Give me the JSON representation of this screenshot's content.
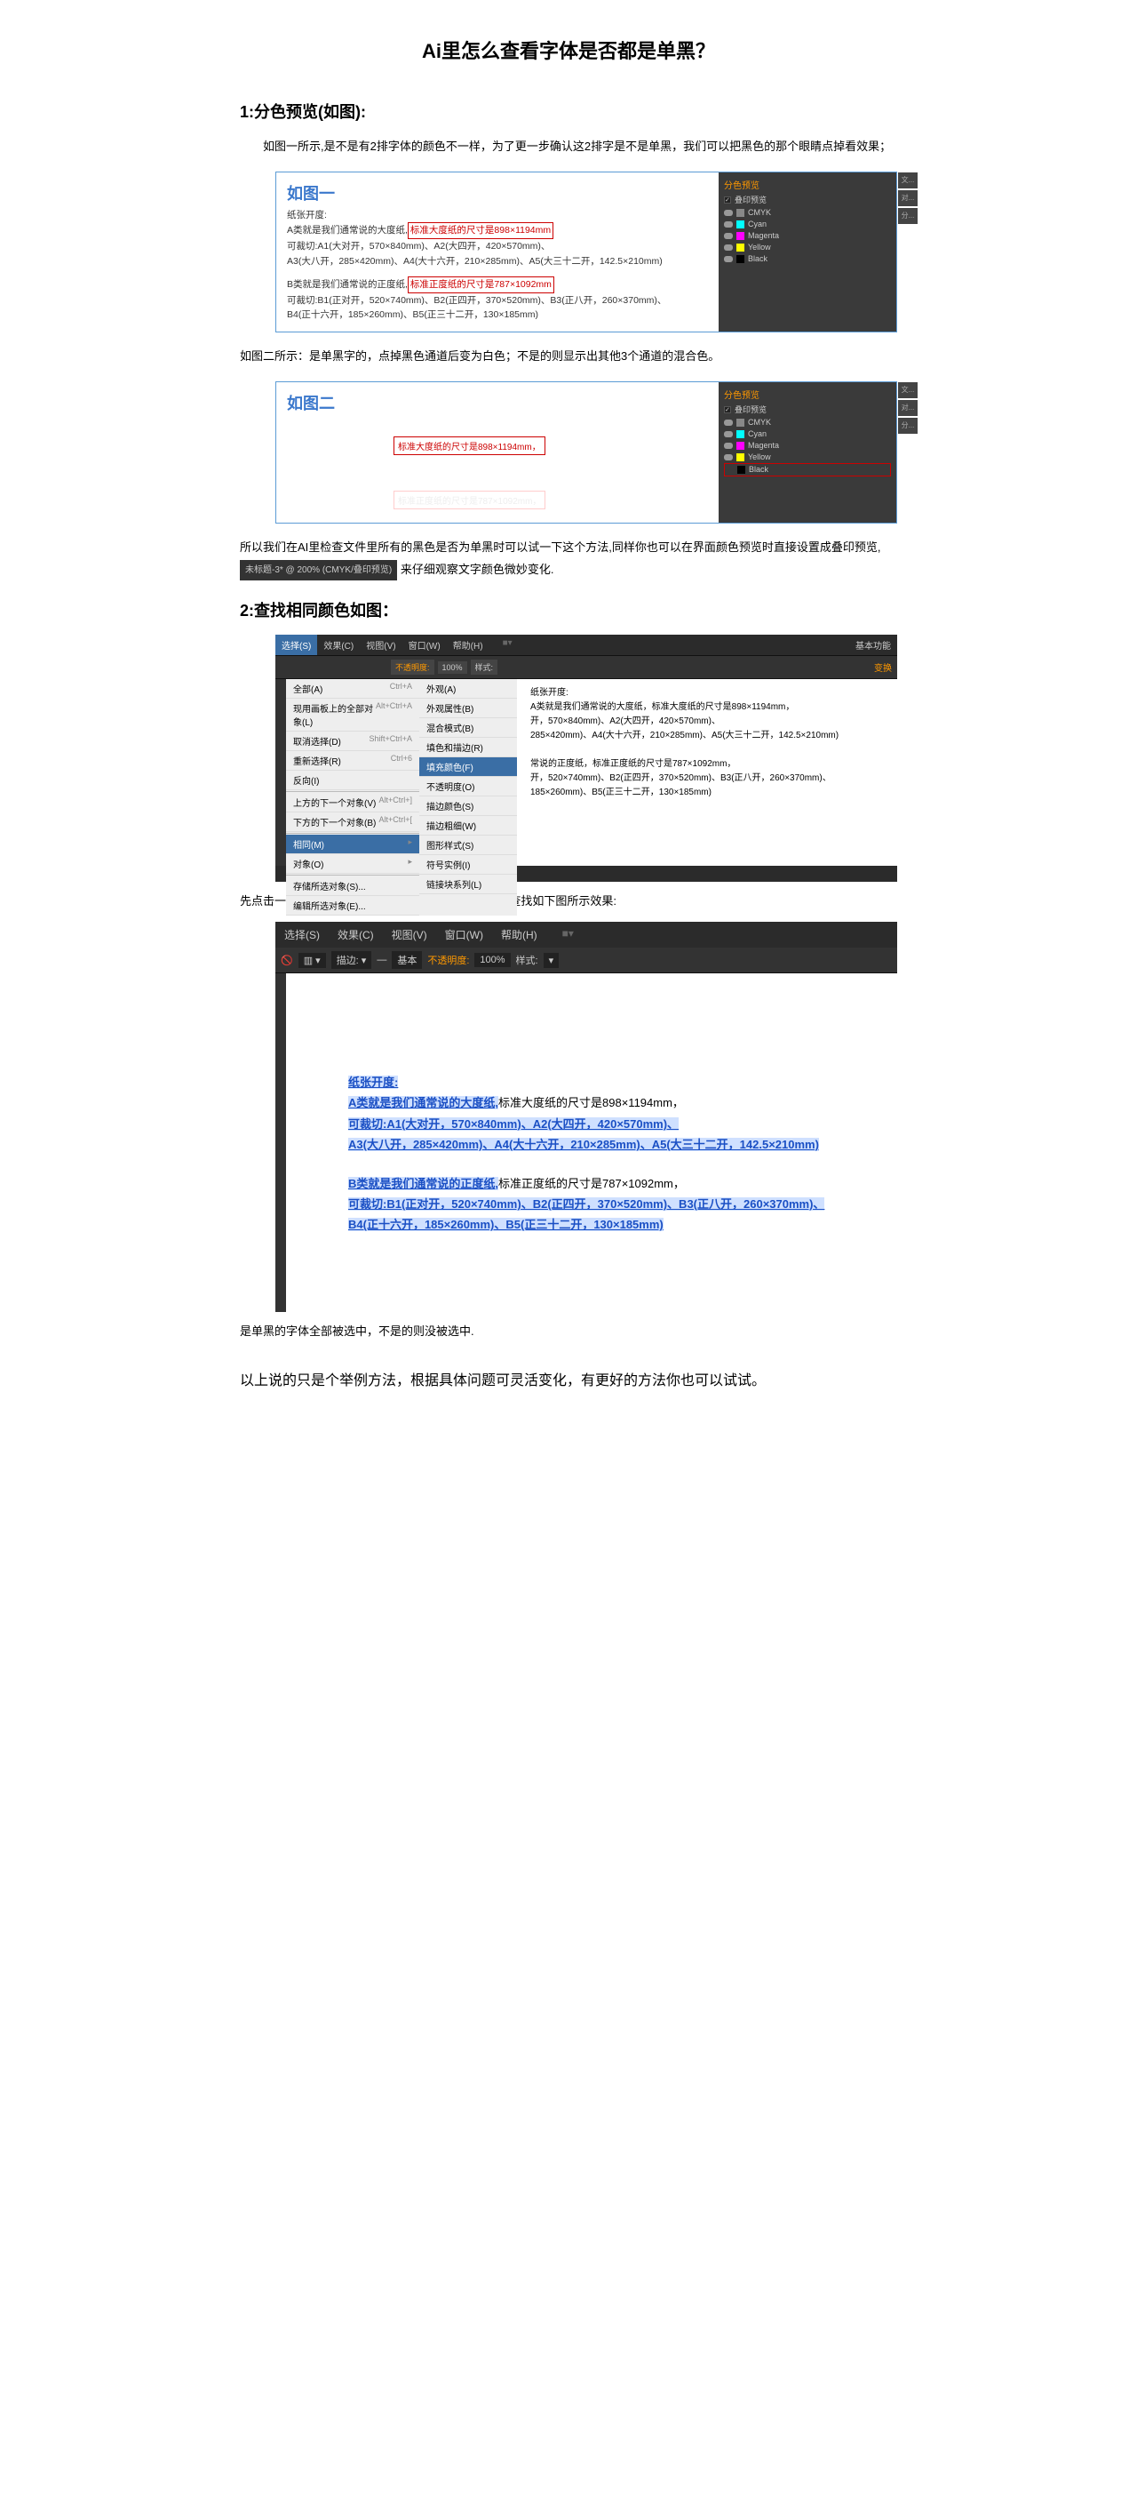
{
  "title": "Ai里怎么查看字体是否都是单黑？",
  "section1": {
    "heading": "1:分色预览(如图):",
    "para1": "如图一所示,是不是有2排字体的颜色不一样，为了更一步确认这2排字是不是单黑，我们可以把黑色的那个眼睛点掉看效果；",
    "para2": "如图二所示：是单黑字的，点掉黑色通道后变为白色；不是的则显示出其他3个通道的混合色。",
    "para3_a": "所以我们在AI里检查文件里所有的黑色是否为单黑时可以试一下这个方法,同样你也可以在界面颜色预览时直接设置成叠印预览,",
    "inline_tab": "未标题-3* @ 200% (CMYK/叠印预览)",
    "para3_b": " 来仔细观察文字颜色微妙变化."
  },
  "fig1": {
    "title": "如图一",
    "l1": "纸张开度:",
    "l2a": "A类就是我们通常说的大度纸,",
    "l2b": "标准大度纸的尺寸是898×1194mm",
    "l3": "可裁切:A1(大对开，570×840mm)、A2(大四开，420×570mm)、",
    "l4": "A3(大八开，285×420mm)、A4(大十六开，210×285mm)、A5(大三十二开，142.5×210mm)",
    "l5a": "B类就是我们通常说的正度纸,",
    "l5b": "标准正度纸的尺寸是787×1092mm",
    "l6": "可裁切:B1(正对开，520×740mm)、B2(正四开，370×520mm)、B3(正八开，260×370mm)、",
    "l7": "B4(正十六开，185×260mm)、B5(正三十二开，130×185mm)",
    "panel_title": "分色预览",
    "chk_overprint": "叠印预览",
    "cmyk": "CMYK",
    "cyan": "Cyan",
    "magenta": "Magenta",
    "yellow": "Yellow",
    "black": "Black",
    "sb1": "文...",
    "sb2": "对...",
    "sb3": "分..."
  },
  "fig2": {
    "title": "如图二",
    "red_txt": "标准大度纸的尺寸是898×1194mm，",
    "ghost_txt": "标准正度纸的尺寸是787×1092mm，"
  },
  "section2": {
    "heading": "2:查找相同颜色如图：",
    "para1": "先点击一个单黑的字体，在(选择-相同-填充颜色)进行查找如下图所示效果:",
    "para2": "是单黑的字体全部被选中，不是的则没被选中."
  },
  "ai_menu": {
    "menubar": [
      "选择(S)",
      "效果(C)",
      "视图(V)",
      "窗口(W)",
      "帮助(H)"
    ],
    "ess": "基本功能",
    "toolbar_opacity_label": "不透明度:",
    "toolbar_opacity_val": "100%",
    "toolbar_style": "样式:",
    "items": [
      {
        "label": "全部(A)",
        "key": "Ctrl+A"
      },
      {
        "label": "现用画板上的全部对象(L)",
        "key": "Alt+Ctrl+A"
      },
      {
        "label": "取消选择(D)",
        "key": "Shift+Ctrl+A"
      },
      {
        "label": "重新选择(R)",
        "key": "Ctrl+6"
      },
      {
        "label": "反向(I)",
        "key": ""
      }
    ],
    "items2": [
      {
        "label": "上方的下一个对象(V)",
        "key": "Alt+Ctrl+]"
      },
      {
        "label": "下方的下一个对象(B)",
        "key": "Alt+Ctrl+["
      }
    ],
    "items3": [
      {
        "label": "相同(M)",
        "key": "▸",
        "sel": true
      },
      {
        "label": "对象(O)",
        "key": "▸"
      }
    ],
    "items4": [
      {
        "label": "存储所选对象(S)...",
        "key": ""
      },
      {
        "label": "编辑所选对象(E)...",
        "key": ""
      }
    ],
    "submenu": [
      "外观(A)",
      "外观属性(B)",
      "混合模式(B)",
      "填色和描边(R)",
      "填充颜色(F)",
      "不透明度(O)",
      "描边颜色(S)",
      "描边粗细(W)",
      "图形样式(S)",
      "符号实例(I)",
      "链接块系列(L)"
    ],
    "submenu_sel_idx": 4,
    "canvas_header": "纸张开度:",
    "canvas_lines": [
      "A类就是我们通常说的大度纸，标准大度纸的尺寸是898×1194mm，",
      "开，570×840mm)、A2(大四开，420×570mm)、",
      "285×420mm)、A4(大十六开，210×285mm)、A5(大三十二开，142.5×210mm)",
      "",
      "常说的正度纸，标准正度纸的尺寸是787×1092mm，",
      "开，520×740mm)、B2(正四开，370×520mm)、B3(正八开，260×370mm)、",
      "185×260mm)、B5(正三十二开，130×185mm)"
    ]
  },
  "ai_result": {
    "menubar": [
      "选择(S)",
      "效果(C)",
      "视图(V)",
      "窗口(W)",
      "帮助(H)"
    ],
    "basic": "基本",
    "opacity_label": "不透明度:",
    "opacity_val": "100%",
    "style": "样式:",
    "para_a1": "纸张开度:",
    "para_a2": "A类就是我们通常说的大度纸,",
    "para_a2_plain": "标准大度纸的尺寸是898×1194mm，",
    "para_a3": "可裁切:A1(大对开，570×840mm)、A2(大四开，420×570mm)、",
    "para_a4": "A3(大八开，285×420mm)、A4(大十六开，210×285mm)、A5(大三十二开，142.5×210mm)",
    "para_b1": "B类就是我们通常说的正度纸,",
    "para_b1_plain": "标准正度纸的尺寸是787×1092mm，",
    "para_b2": "可裁切:B1(正对开，520×740mm)、B2(正四开，370×520mm)、B3(正八开，260×370mm)、",
    "para_b3": "B4(正十六开，185×260mm)、B5(正三十二开，130×185mm)"
  },
  "closing": "以上说的只是个举例方法，根据具体问题可灵活变化，有更好的方法你也可以试试。"
}
